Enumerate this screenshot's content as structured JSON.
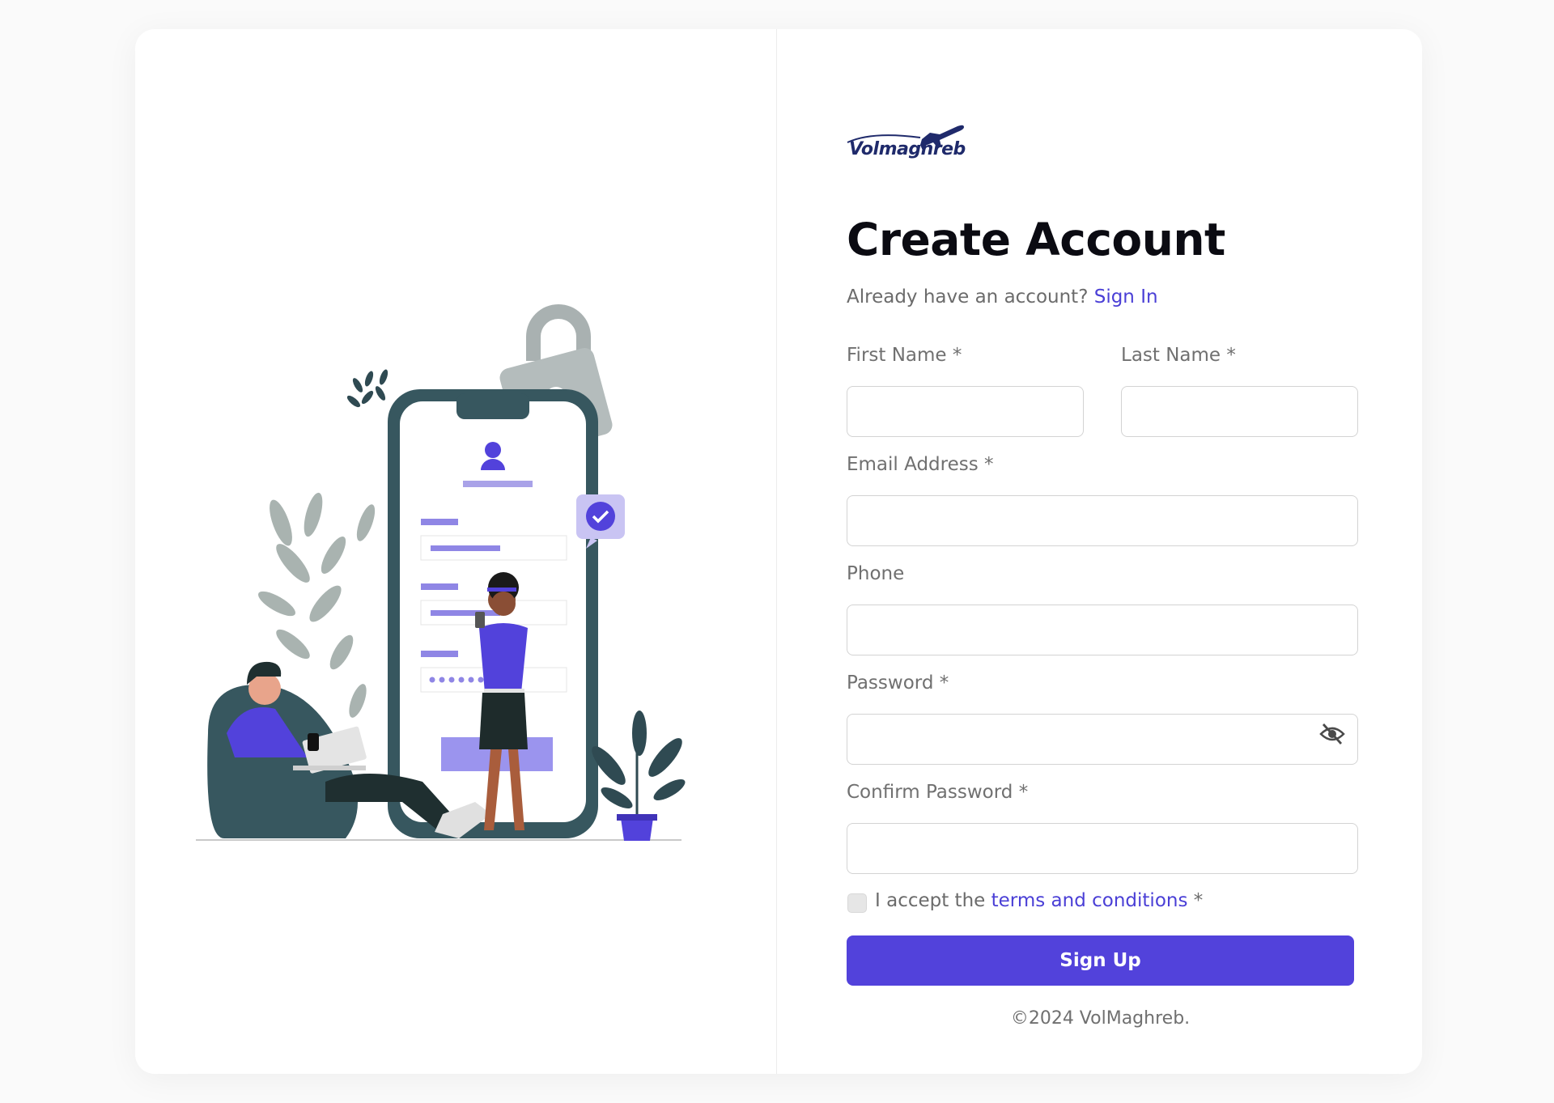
{
  "brand": {
    "logo_text": "Volmaghreb",
    "accent_color": "#5242db"
  },
  "form": {
    "title": "Create Account",
    "subtitle_prefix": "Already have an account?",
    "sign_in_link": "Sign In",
    "fields": {
      "first_name": {
        "label": "First Name *",
        "value": ""
      },
      "last_name": {
        "label": "Last Name *",
        "value": ""
      },
      "email": {
        "label": "Email Address *",
        "value": ""
      },
      "phone": {
        "label": "Phone",
        "value": ""
      },
      "password": {
        "label": "Password *",
        "value": "",
        "toggle_icon": "eye-slash-icon"
      },
      "confirm_password": {
        "label": "Confirm Password *",
        "value": ""
      }
    },
    "terms": {
      "prefix": "I accept the",
      "link": "terms and conditions",
      "suffix": "*",
      "checked": false
    },
    "submit_label": "Sign Up"
  },
  "footer": {
    "copyright": "©2024 VolMaghreb."
  }
}
